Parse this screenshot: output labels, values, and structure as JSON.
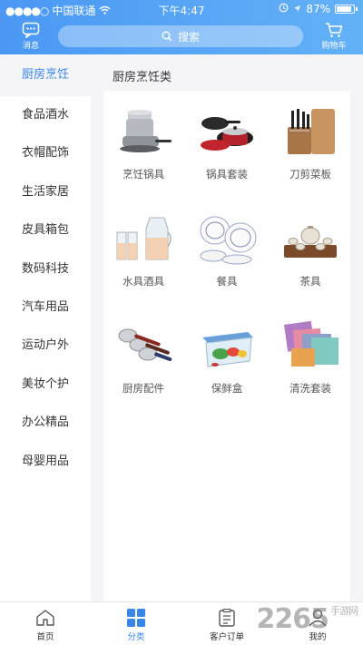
{
  "status_bar": {
    "carrier": "中国联通",
    "time": "下午4:47",
    "battery": "87%"
  },
  "header": {
    "message_label": "消息",
    "search_placeholder": "搜索",
    "cart_label": "购物车"
  },
  "sidebar": {
    "items": [
      {
        "label": "厨房烹饪",
        "active": true
      },
      {
        "label": "食品酒水"
      },
      {
        "label": "衣帽配饰"
      },
      {
        "label": "生活家居"
      },
      {
        "label": "皮具箱包"
      },
      {
        "label": "数码科技"
      },
      {
        "label": "汽车用品"
      },
      {
        "label": "运动户外"
      },
      {
        "label": "美妆个护"
      },
      {
        "label": "办公精品"
      },
      {
        "label": "母婴用品"
      }
    ]
  },
  "main": {
    "section_title": "厨房烹饪类",
    "products": [
      {
        "label": "烹饪锅具",
        "icon": "cookware-icon"
      },
      {
        "label": "锅具套装",
        "icon": "pan-set-icon"
      },
      {
        "label": "刀剪菜板",
        "icon": "knife-board-icon"
      },
      {
        "label": "水具酒具",
        "icon": "glassware-icon"
      },
      {
        "label": "餐具",
        "icon": "tableware-icon"
      },
      {
        "label": "茶具",
        "icon": "tea-set-icon"
      },
      {
        "label": "厨房配件",
        "icon": "kitchen-tools-icon"
      },
      {
        "label": "保鲜盒",
        "icon": "food-container-icon"
      },
      {
        "label": "清洗套装",
        "icon": "cleaning-cloth-icon"
      }
    ]
  },
  "tabbar": {
    "tabs": [
      {
        "label": "首页",
        "icon": "home-icon"
      },
      {
        "label": "分类",
        "icon": "category-icon",
        "active": true
      },
      {
        "label": "客户订单",
        "icon": "order-icon"
      },
      {
        "label": "我的",
        "icon": "profile-icon"
      }
    ]
  },
  "watermark": {
    "text": "2265",
    "sub": "手游网"
  },
  "colors": {
    "accent": "#3a86e8",
    "header_start": "#4a98f3",
    "header_end": "#63b1f7"
  }
}
